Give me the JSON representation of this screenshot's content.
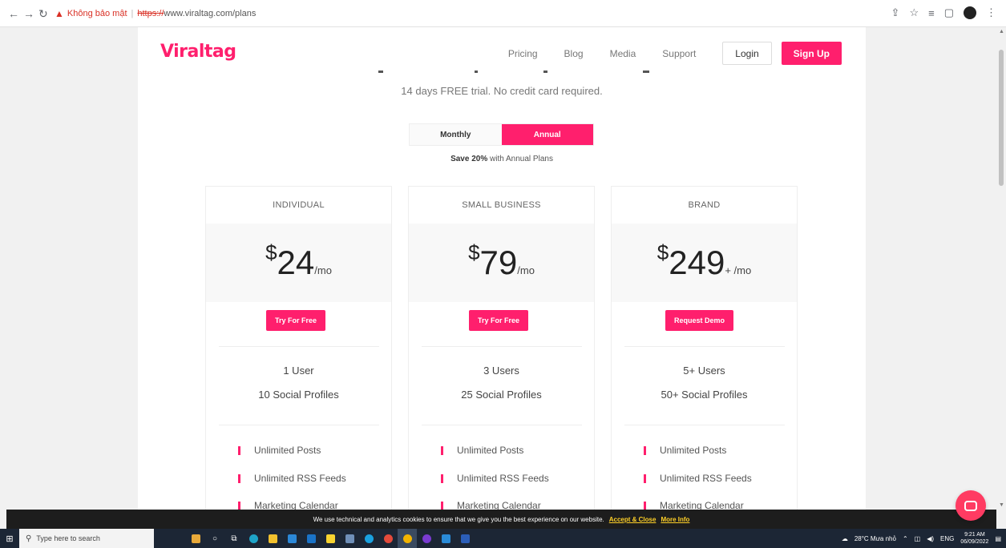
{
  "browser": {
    "not_secure": "Không bảo mật",
    "protocol": "https://",
    "url_rest": "www.viraltag.com/plans"
  },
  "header": {
    "logo": "Viraltag",
    "menu": [
      "Pricing",
      "Blog",
      "Media",
      "Support"
    ],
    "login": "Login",
    "signup": "Sign Up"
  },
  "hero": {
    "trial": "14 days FREE trial. No credit card required.",
    "toggle_monthly": "Monthly",
    "toggle_annual": "Annual",
    "toggle_selected": "Annual",
    "save_bold": "Save 20%",
    "save_rest": " with Annual Plans"
  },
  "plans": [
    {
      "name": "INDIVIDUAL",
      "currency": "$",
      "amount": "24",
      "period": "/mo",
      "cta": "Try For Free",
      "users": "1 User",
      "profiles": "10 Social Profiles",
      "features": [
        "Unlimited Posts",
        "Unlimited RSS Feeds",
        "Marketing Calendar"
      ]
    },
    {
      "name": "SMALL BUSINESS",
      "currency": "$",
      "amount": "79",
      "period": "/mo",
      "cta": "Try For Free",
      "users": "3 Users",
      "profiles": "25 Social Profiles",
      "features": [
        "Unlimited Posts",
        "Unlimited RSS Feeds",
        "Marketing Calendar"
      ]
    },
    {
      "name": "BRAND",
      "currency": "$",
      "amount": "249",
      "period": "+ /mo",
      "cta": "Request Demo",
      "users": "5+ Users",
      "profiles": "50+ Social Profiles",
      "features": [
        "Unlimited Posts",
        "Unlimited RSS Feeds",
        "Marketing Calendar"
      ]
    }
  ],
  "cookie": {
    "text": "We use technical and analytics cookies to ensure that we give you the best experience on our website.",
    "accept": "Accept & Close",
    "more": "More Info"
  },
  "taskbar": {
    "search_placeholder": "Type here to search",
    "weather": "28°C  Mưa nhỏ",
    "lang": "ENG",
    "time": "9:21 AM",
    "date": "06/09/2022"
  },
  "colors": {
    "brand": "#ff1f6d",
    "taskbar": "#1c2635"
  }
}
